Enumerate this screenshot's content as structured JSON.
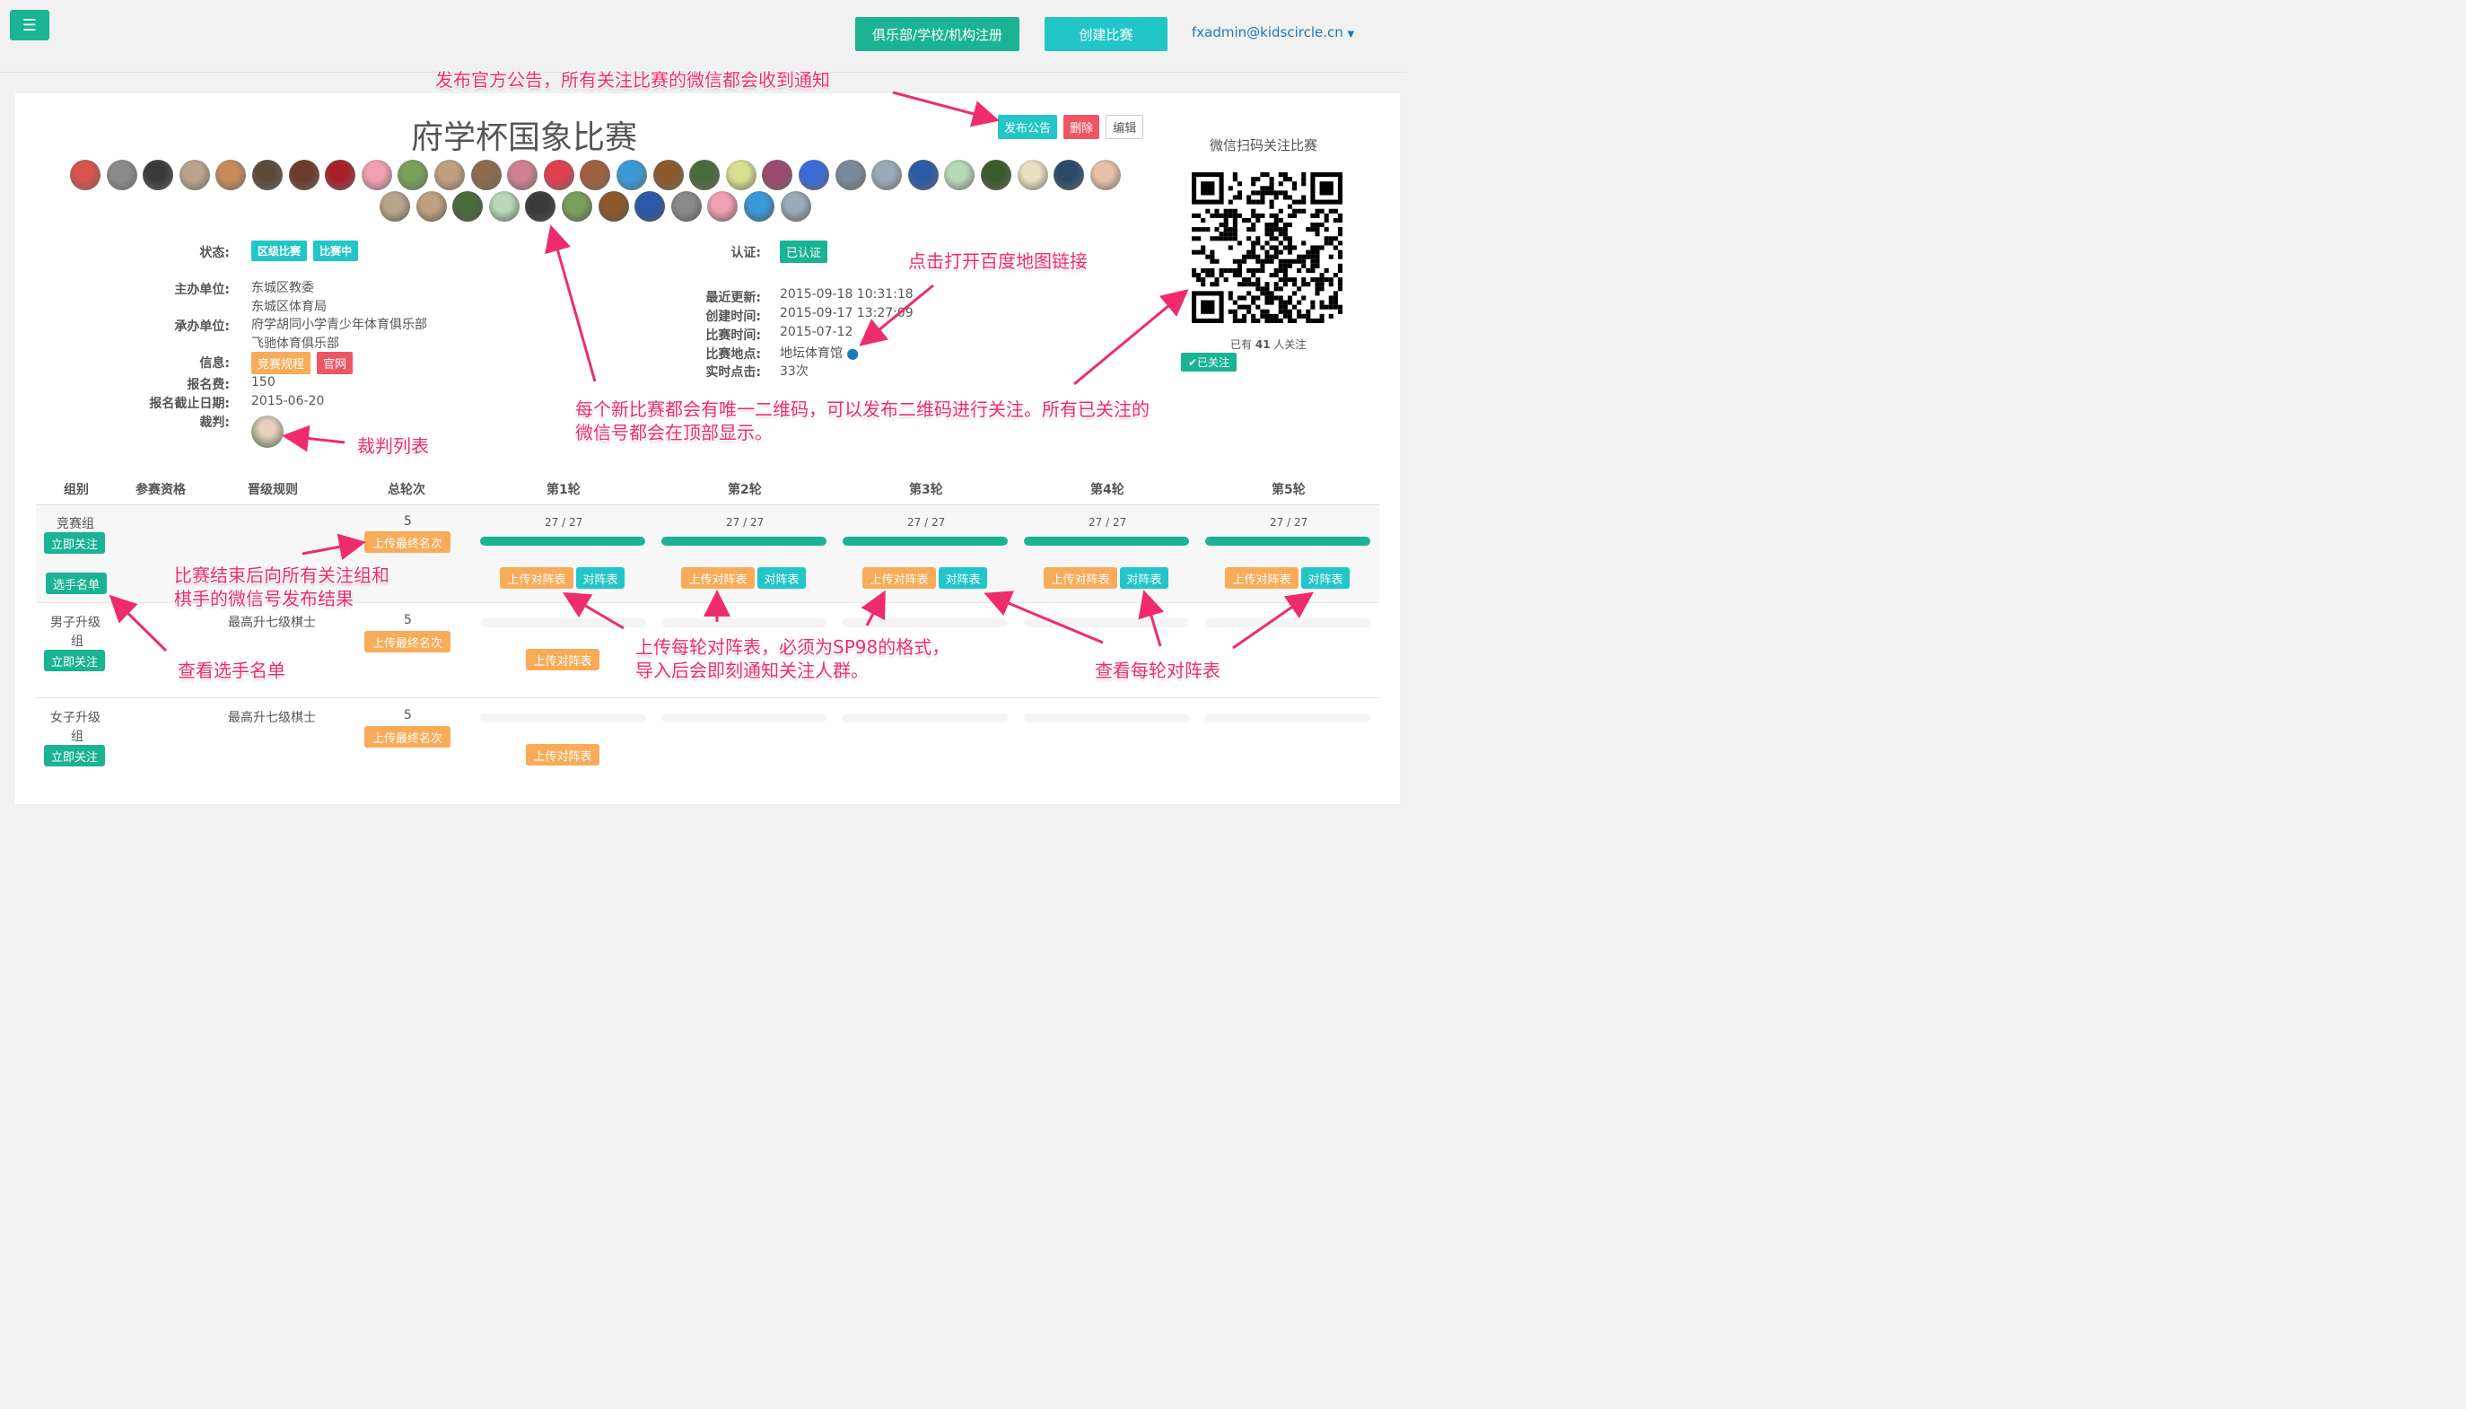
{
  "header": {
    "register_label": "俱乐部/学校/机构注册",
    "create_label": "创建比赛",
    "user_email": "fxadmin@kidscircle.cn"
  },
  "competition": {
    "title": "府学杯国象比赛",
    "publish_label": "发布公告",
    "delete_label": "删除",
    "edit_label": "编辑",
    "qr_title": "微信扫码关注比赛",
    "followers_prefix": "已有",
    "followers_count": "41",
    "followers_suffix": "人关注",
    "followed_label": "✔已关注"
  },
  "info": {
    "status_label": "状态:",
    "status_tags": [
      "区级比赛",
      "比赛中"
    ],
    "host_label": "主办单位:",
    "host_values": [
      "东城区教委",
      "东城区体育局"
    ],
    "organizer_label": "承办单位:",
    "organizer_values": [
      "府学胡同小学青少年体育俱乐部",
      "飞驰体育俱乐部"
    ],
    "info_label": "信息:",
    "info_tags": [
      "竞赛规程",
      "官网"
    ],
    "fee_label": "报名费:",
    "fee_value": "150",
    "deadline_label": "报名截止日期:",
    "deadline_value": "2015-06-20",
    "referee_label": "裁判:",
    "cert_label": "认证:",
    "cert_value": "已认证",
    "updated_label": "最近更新:",
    "updated_value": "2015-09-18 10:31:18",
    "created_label": "创建时间:",
    "created_value": "2015-09-17 13:27:09",
    "date_label": "比赛时间:",
    "date_value": "2015-07-12",
    "venue_label": "比赛地点:",
    "venue_value": "地坛体育馆",
    "clicks_label": "实时点击:",
    "clicks_value": "33次"
  },
  "table": {
    "headers": [
      "组别",
      "参赛资格",
      "晋级规则",
      "总轮次",
      "第1轮",
      "第2轮",
      "第3轮",
      "第4轮",
      "第5轮"
    ],
    "follow_label": "立即关注",
    "players_label": "选手名单",
    "final_label": "上传最终名次",
    "upload_label": "上传对阵表",
    "pairing_label": "对阵表",
    "rows": [
      {
        "group": "竞赛组",
        "rule": "",
        "rounds": "5",
        "progress": [
          "27 / 27",
          "27 / 27",
          "27 / 27",
          "27 / 27",
          "27 / 27"
        ]
      },
      {
        "group_l1": "男子升级",
        "group_l2": "组",
        "rule": "最高升七级棋士",
        "rounds": "5"
      },
      {
        "group_l1": "女子升级",
        "group_l2": "组",
        "rule": "最高升七级棋士",
        "rounds": "5"
      }
    ]
  },
  "annotations": {
    "publish": "发布官方公告，所有关注比赛的微信都会收到通知",
    "map": "点击打开百度地图链接",
    "qr_l1": "每个新比赛都会有唯一二维码，可以发布二维码进行关注。所有已关注的",
    "qr_l2": "微信号都会在顶部显示。",
    "referee": "裁判列表",
    "result_l1": "比赛结束后向所有关注组和",
    "result_l2": "棋手的微信号发布结果",
    "players": "查看选手名单",
    "upload_l1": "上传每轮对阵表，必须为SP98的格式，",
    "upload_l2": "导入后会即刻通知关注人群。",
    "view": "查看每轮对阵表"
  },
  "colors": {
    "green": "#1ab394",
    "teal": "#23c6c8",
    "orange": "#f8ac59",
    "red": "#ed5565",
    "annotation": "#ee2c6b"
  }
}
